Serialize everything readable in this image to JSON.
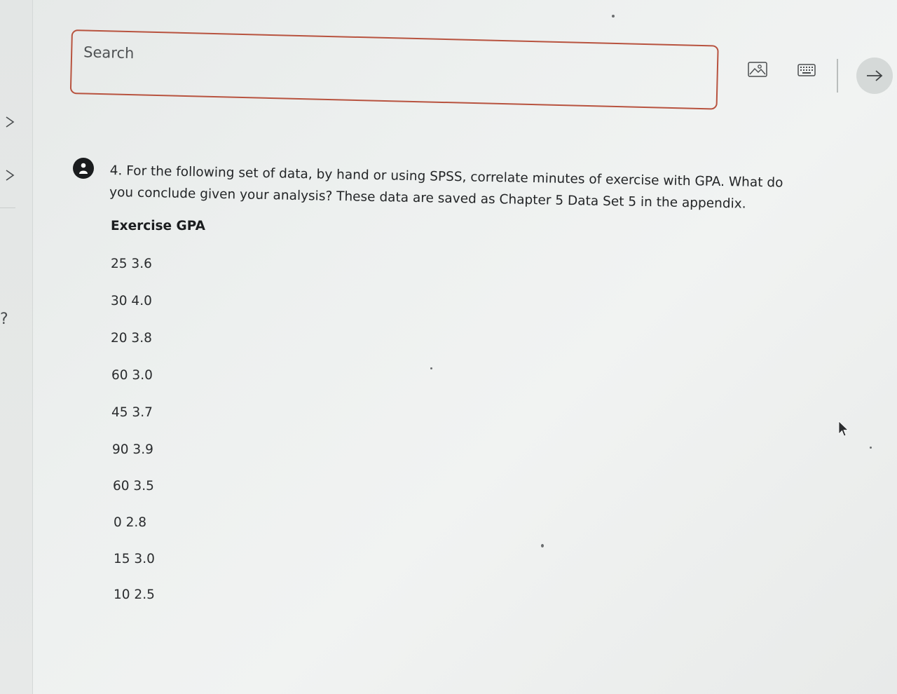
{
  "search": {
    "placeholder": "Search"
  },
  "toolbar": {
    "image_icon": "image-icon",
    "keyboard_icon": "keyboard-icon",
    "submit_icon": "arrow-right-icon"
  },
  "sidebar": {
    "question_mark": "?"
  },
  "question": {
    "text": "4. For the following set of data, by hand or using SPSS, correlate minutes of exercise with GPA. What do you conclude given your analysis? These data are saved as Chapter 5 Data Set 5 in the appendix.",
    "header": "Exercise GPA",
    "rows": [
      "25 3.6",
      "30 4.0",
      "20 3.8",
      "60 3.0",
      "45 3.7",
      "90 3.9",
      "60 3.5",
      "0 2.8",
      "15 3.0",
      "10 2.5"
    ]
  },
  "colors": {
    "search_border": "#b8533f",
    "badge": "#1a1c1e",
    "submit_button": "#d5d9d8"
  }
}
